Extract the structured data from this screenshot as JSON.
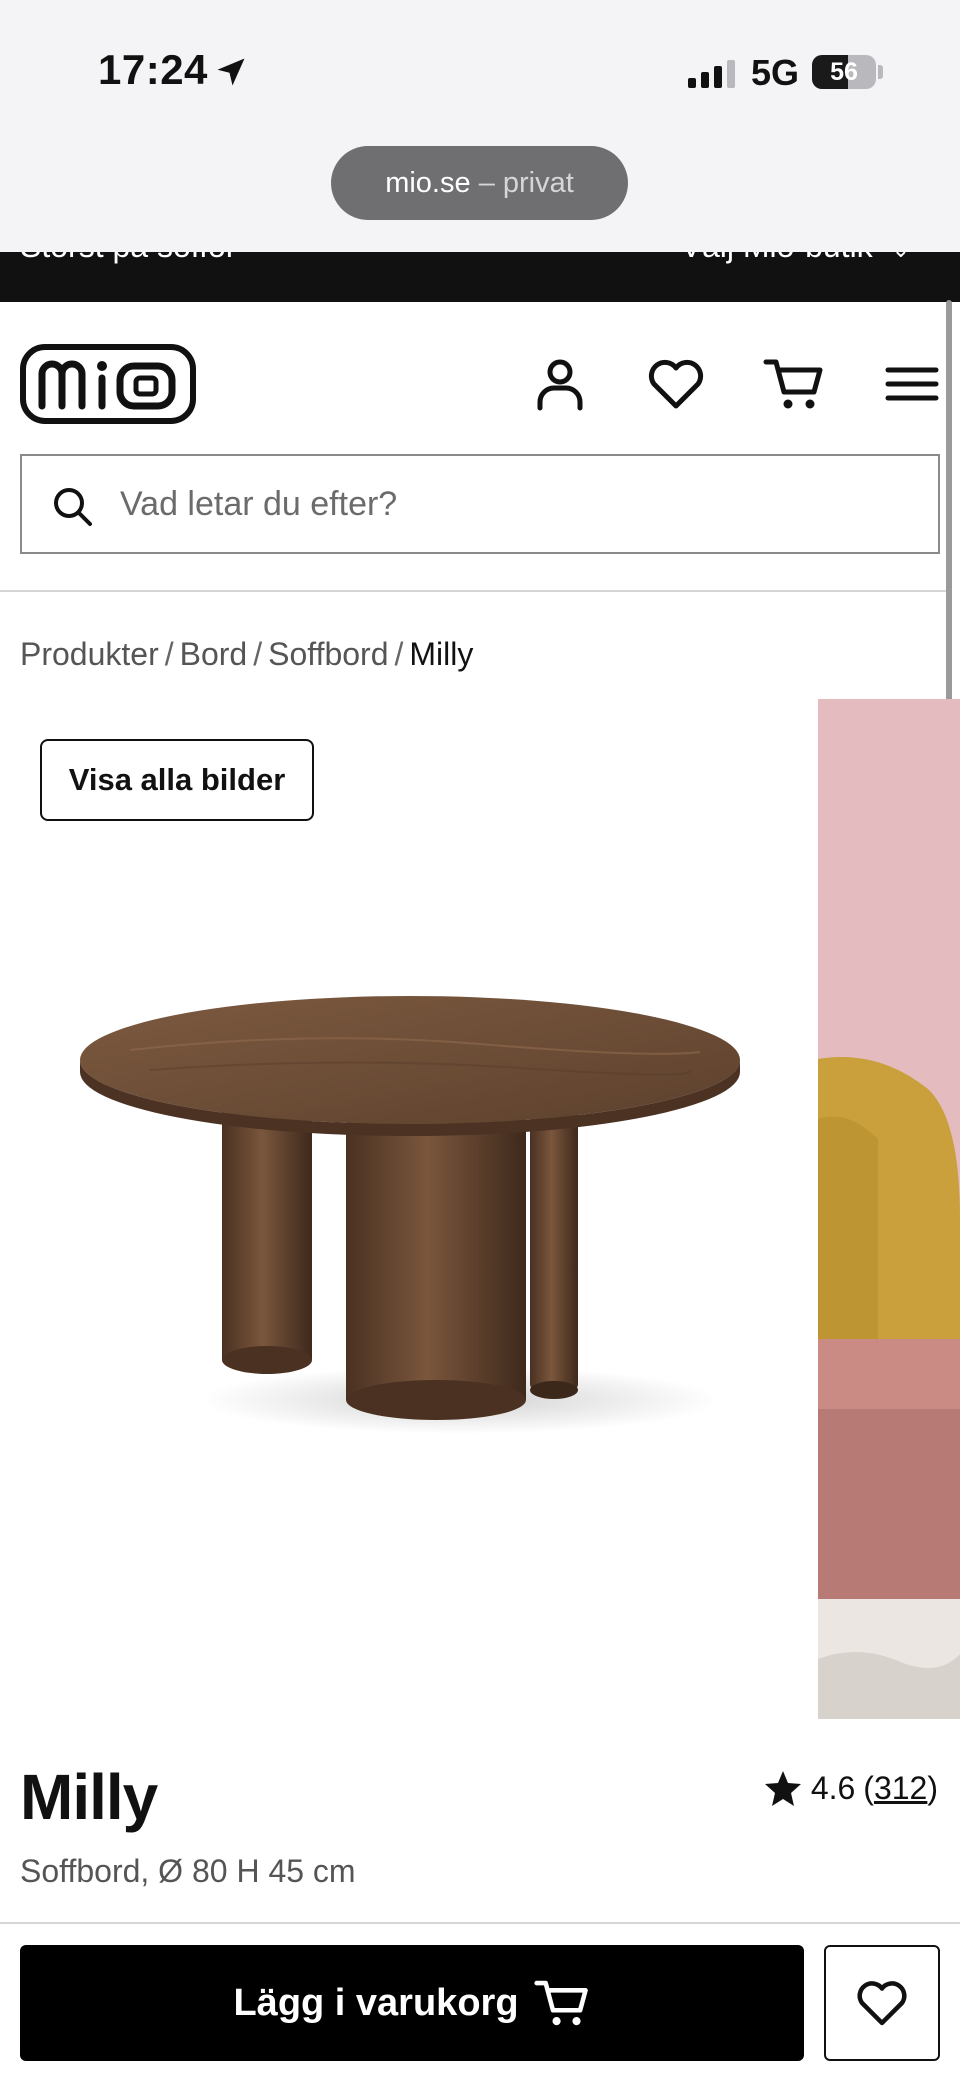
{
  "status_bar": {
    "time": "17:24",
    "network": "5G",
    "battery": "56",
    "battery_level": 0.56
  },
  "browser": {
    "domain": "mio.se",
    "mode": "– privat"
  },
  "promo_bar": {
    "left_text": "Störst på soffor",
    "right_text": "Välj Mio-butik"
  },
  "header": {
    "logo_text": "mio",
    "icons": [
      "user-icon",
      "heart-icon",
      "cart-icon",
      "menu-icon"
    ]
  },
  "search": {
    "placeholder": "Vad letar du efter?"
  },
  "breadcrumb": {
    "items": [
      "Produkter",
      "Bord",
      "Soffbord"
    ],
    "current": "Milly",
    "separator": "/"
  },
  "gallery": {
    "show_all_label": "Visa alla bilder"
  },
  "product": {
    "name": "Milly",
    "subtitle": "Soffbord, Ø 80 H 45 cm",
    "rating": "4.6",
    "review_count": "312",
    "rating_open": "(",
    "rating_close": ")"
  },
  "actions": {
    "add_to_cart_label": "Lägg i varukorg"
  },
  "colors": {
    "accent": "#000000",
    "wood": "#6b4a33",
    "side_image_pink": "#e4bcc0"
  }
}
